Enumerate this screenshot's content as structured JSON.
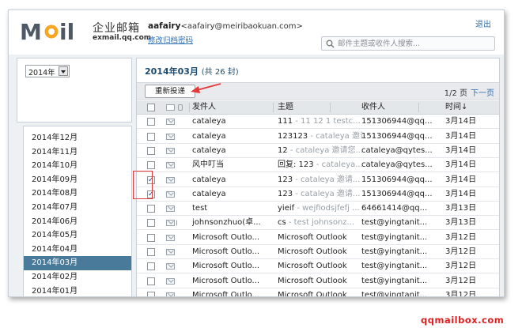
{
  "header": {
    "logo_text": "MOil",
    "brand_title": "企业邮箱",
    "brand_domain": "exmail.qq.com",
    "user_name": "aafairy",
    "user_email": "<aafairy@meiribaokuan.com>",
    "password_link": "修改归档密码",
    "logout_label": "退出",
    "search_placeholder": "邮件主题或收件人搜索..."
  },
  "sidebar": {
    "year_value": "2014年",
    "months": [
      {
        "label": "2014年12月",
        "active": false
      },
      {
        "label": "2014年11月",
        "active": false
      },
      {
        "label": "2014年10月",
        "active": false
      },
      {
        "label": "2014年09月",
        "active": false
      },
      {
        "label": "2014年08月",
        "active": false
      },
      {
        "label": "2014年07月",
        "active": false
      },
      {
        "label": "2014年06月",
        "active": false
      },
      {
        "label": "2014年05月",
        "active": false
      },
      {
        "label": "2014年04月",
        "active": false
      },
      {
        "label": "2014年03月",
        "active": true
      },
      {
        "label": "2014年02月",
        "active": false
      },
      {
        "label": "2014年01月",
        "active": false
      }
    ]
  },
  "main": {
    "title": "2014年03月",
    "count": "(共 26 封)",
    "refresh_label": "重新投递",
    "pager_text": "1/2 页",
    "next_page_label": "下一页",
    "columns": {
      "from": "发件人",
      "subject": "主题",
      "to": "收件人",
      "time": "时间↓"
    },
    "rows": [
      {
        "checked": false,
        "attach": false,
        "from": "cataleya",
        "subject": "111",
        "preview": " - 11 12 1 testc...",
        "to": "151306944@qq...",
        "time": "3月14日"
      },
      {
        "checked": false,
        "attach": false,
        "from": "cataleya",
        "subject": "123123",
        "preview": " - cataleya 邀请您",
        "to": "151306944@qq...",
        "time": "3月14日"
      },
      {
        "checked": false,
        "attach": false,
        "from": "cataleya",
        "subject": "12",
        "preview": " - cataleya 邀请您...",
        "to": "cataleya@qytes...",
        "time": "3月14日"
      },
      {
        "checked": false,
        "attach": false,
        "from": "风中叮当",
        "subject": "回复: 123",
        "preview": " - cataleya...",
        "to": "cataleya@qytes...",
        "time": "3月14日"
      },
      {
        "checked": true,
        "attach": false,
        "from": "cataleya",
        "subject": "123",
        "preview": " - cataleya 邀请...",
        "to": "151306944@qq...",
        "time": "3月14日"
      },
      {
        "checked": true,
        "attach": false,
        "from": "cataleya",
        "subject": "123",
        "preview": " - cataleya 邀请...",
        "to": "151306944@qq...",
        "time": "3月14日"
      },
      {
        "checked": false,
        "attach": false,
        "from": "test",
        "subject": "yieif",
        "preview": " - wejfiodsjfefj ...",
        "to": "64661414@qq...",
        "time": "3月13日"
      },
      {
        "checked": false,
        "attach": true,
        "from": "johnsonzhuo(卓...",
        "subject": "cs",
        "preview": " - test johnsonz...",
        "to": "test@yingtanit...",
        "time": "3月13日"
      },
      {
        "checked": false,
        "attach": false,
        "from": "Microsoft Outlo...",
        "subject": "Microsoft Outlook",
        "preview": "",
        "to": "test@yingtanit...",
        "time": "3月12日"
      },
      {
        "checked": false,
        "attach": false,
        "from": "Microsoft Outlo...",
        "subject": "Microsoft Outlook",
        "preview": "",
        "to": "test@yingtanit...",
        "time": "3月12日"
      },
      {
        "checked": false,
        "attach": false,
        "from": "Microsoft Outlo...",
        "subject": "Microsoft Outlook",
        "preview": "",
        "to": "test@yingtanit...",
        "time": "3月12日"
      },
      {
        "checked": false,
        "attach": false,
        "from": "Microsoft Outlo...",
        "subject": "Microsoft Outlook",
        "preview": "",
        "to": "test@yingtanit...",
        "time": "3月12日"
      },
      {
        "checked": false,
        "attach": false,
        "from": "Microsoft Outlo...",
        "subject": "Microsoft Outlook",
        "preview": "",
        "to": "test@yingtanit...",
        "time": "3月12日"
      }
    ]
  },
  "watermark": "qqmailbox.com",
  "colors": {
    "accent": "#4a7a9a",
    "link": "#2a6fb3",
    "title": "#1f4b6e",
    "annotation": "#e23a3a"
  }
}
